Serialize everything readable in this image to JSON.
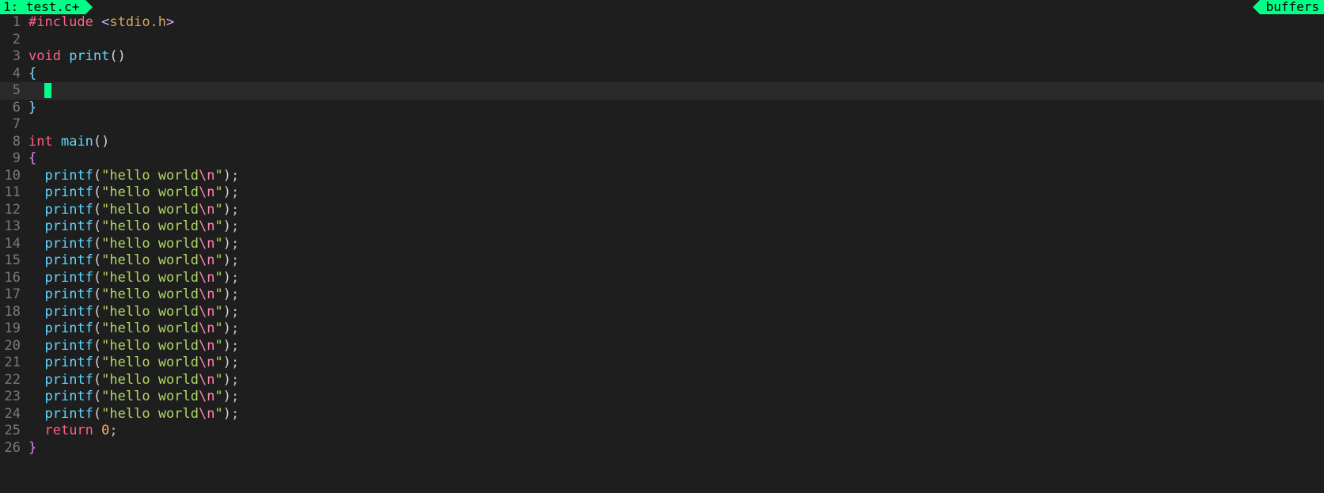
{
  "topbar": {
    "tab_label": "1: test.c+",
    "buffers_label": "buffers"
  },
  "editor": {
    "cursor_line": 5,
    "lines": [
      {
        "n": 1,
        "tokens": [
          [
            "kw-red",
            "#include "
          ],
          [
            "angle",
            "<"
          ],
          [
            "hdr",
            "stdio.h"
          ],
          [
            "angle",
            ">"
          ]
        ]
      },
      {
        "n": 2,
        "tokens": []
      },
      {
        "n": 3,
        "tokens": [
          [
            "kw-red",
            "void "
          ],
          [
            "fn-blue",
            "print"
          ],
          [
            "paren",
            "()"
          ]
        ]
      },
      {
        "n": 4,
        "tokens": [
          [
            "brace",
            "{"
          ]
        ]
      },
      {
        "n": 5,
        "tokens": [
          [
            "plain",
            "  "
          ],
          [
            "__CURSOR__",
            ""
          ]
        ]
      },
      {
        "n": 6,
        "tokens": [
          [
            "brace",
            "}"
          ]
        ]
      },
      {
        "n": 7,
        "tokens": []
      },
      {
        "n": 8,
        "tokens": [
          [
            "kw-red",
            "int "
          ],
          [
            "fn-blue",
            "main"
          ],
          [
            "paren",
            "()"
          ]
        ]
      },
      {
        "n": 9,
        "tokens": [
          [
            "brace2",
            "{"
          ]
        ]
      },
      {
        "n": 10,
        "tokens": [
          [
            "plain",
            "  "
          ],
          [
            "fn-blue",
            "printf"
          ],
          [
            "paren",
            "("
          ],
          [
            "dq",
            "\""
          ],
          [
            "str",
            "hello world"
          ],
          [
            "esc",
            "\\n"
          ],
          [
            "dq",
            "\""
          ],
          [
            "paren",
            ")"
          ],
          [
            "punct",
            ";"
          ]
        ]
      },
      {
        "n": 11,
        "tokens": [
          [
            "plain",
            "  "
          ],
          [
            "fn-blue",
            "printf"
          ],
          [
            "paren",
            "("
          ],
          [
            "dq",
            "\""
          ],
          [
            "str",
            "hello world"
          ],
          [
            "esc",
            "\\n"
          ],
          [
            "dq",
            "\""
          ],
          [
            "paren",
            ")"
          ],
          [
            "punct",
            ";"
          ]
        ]
      },
      {
        "n": 12,
        "tokens": [
          [
            "plain",
            "  "
          ],
          [
            "fn-blue",
            "printf"
          ],
          [
            "paren",
            "("
          ],
          [
            "dq",
            "\""
          ],
          [
            "str",
            "hello world"
          ],
          [
            "esc",
            "\\n"
          ],
          [
            "dq",
            "\""
          ],
          [
            "paren",
            ")"
          ],
          [
            "punct",
            ";"
          ]
        ]
      },
      {
        "n": 13,
        "tokens": [
          [
            "plain",
            "  "
          ],
          [
            "fn-blue",
            "printf"
          ],
          [
            "paren",
            "("
          ],
          [
            "dq",
            "\""
          ],
          [
            "str",
            "hello world"
          ],
          [
            "esc",
            "\\n"
          ],
          [
            "dq",
            "\""
          ],
          [
            "paren",
            ")"
          ],
          [
            "punct",
            ";"
          ]
        ]
      },
      {
        "n": 14,
        "tokens": [
          [
            "plain",
            "  "
          ],
          [
            "fn-blue",
            "printf"
          ],
          [
            "paren",
            "("
          ],
          [
            "dq",
            "\""
          ],
          [
            "str",
            "hello world"
          ],
          [
            "esc",
            "\\n"
          ],
          [
            "dq",
            "\""
          ],
          [
            "paren",
            ")"
          ],
          [
            "punct",
            ";"
          ]
        ]
      },
      {
        "n": 15,
        "tokens": [
          [
            "plain",
            "  "
          ],
          [
            "fn-blue",
            "printf"
          ],
          [
            "paren",
            "("
          ],
          [
            "dq",
            "\""
          ],
          [
            "str",
            "hello world"
          ],
          [
            "esc",
            "\\n"
          ],
          [
            "dq",
            "\""
          ],
          [
            "paren",
            ")"
          ],
          [
            "punct",
            ";"
          ]
        ]
      },
      {
        "n": 16,
        "tokens": [
          [
            "plain",
            "  "
          ],
          [
            "fn-blue",
            "printf"
          ],
          [
            "paren",
            "("
          ],
          [
            "dq",
            "\""
          ],
          [
            "str",
            "hello world"
          ],
          [
            "esc",
            "\\n"
          ],
          [
            "dq",
            "\""
          ],
          [
            "paren",
            ")"
          ],
          [
            "punct",
            ";"
          ]
        ]
      },
      {
        "n": 17,
        "tokens": [
          [
            "plain",
            "  "
          ],
          [
            "fn-blue",
            "printf"
          ],
          [
            "paren",
            "("
          ],
          [
            "dq",
            "\""
          ],
          [
            "str",
            "hello world"
          ],
          [
            "esc",
            "\\n"
          ],
          [
            "dq",
            "\""
          ],
          [
            "paren",
            ")"
          ],
          [
            "punct",
            ";"
          ]
        ]
      },
      {
        "n": 18,
        "tokens": [
          [
            "plain",
            "  "
          ],
          [
            "fn-blue",
            "printf"
          ],
          [
            "paren",
            "("
          ],
          [
            "dq",
            "\""
          ],
          [
            "str",
            "hello world"
          ],
          [
            "esc",
            "\\n"
          ],
          [
            "dq",
            "\""
          ],
          [
            "paren",
            ")"
          ],
          [
            "punct",
            ";"
          ]
        ]
      },
      {
        "n": 19,
        "tokens": [
          [
            "plain",
            "  "
          ],
          [
            "fn-blue",
            "printf"
          ],
          [
            "paren",
            "("
          ],
          [
            "dq",
            "\""
          ],
          [
            "str",
            "hello world"
          ],
          [
            "esc",
            "\\n"
          ],
          [
            "dq",
            "\""
          ],
          [
            "paren",
            ")"
          ],
          [
            "punct",
            ";"
          ]
        ]
      },
      {
        "n": 20,
        "tokens": [
          [
            "plain",
            "  "
          ],
          [
            "fn-blue",
            "printf"
          ],
          [
            "paren",
            "("
          ],
          [
            "dq",
            "\""
          ],
          [
            "str",
            "hello world"
          ],
          [
            "esc",
            "\\n"
          ],
          [
            "dq",
            "\""
          ],
          [
            "paren",
            ")"
          ],
          [
            "punct",
            ";"
          ]
        ]
      },
      {
        "n": 21,
        "tokens": [
          [
            "plain",
            "  "
          ],
          [
            "fn-blue",
            "printf"
          ],
          [
            "paren",
            "("
          ],
          [
            "dq",
            "\""
          ],
          [
            "str",
            "hello world"
          ],
          [
            "esc",
            "\\n"
          ],
          [
            "dq",
            "\""
          ],
          [
            "paren",
            ")"
          ],
          [
            "punct",
            ";"
          ]
        ]
      },
      {
        "n": 22,
        "tokens": [
          [
            "plain",
            "  "
          ],
          [
            "fn-blue",
            "printf"
          ],
          [
            "paren",
            "("
          ],
          [
            "dq",
            "\""
          ],
          [
            "str",
            "hello world"
          ],
          [
            "esc",
            "\\n"
          ],
          [
            "dq",
            "\""
          ],
          [
            "paren",
            ")"
          ],
          [
            "punct",
            ";"
          ]
        ]
      },
      {
        "n": 23,
        "tokens": [
          [
            "plain",
            "  "
          ],
          [
            "fn-blue",
            "printf"
          ],
          [
            "paren",
            "("
          ],
          [
            "dq",
            "\""
          ],
          [
            "str",
            "hello world"
          ],
          [
            "esc",
            "\\n"
          ],
          [
            "dq",
            "\""
          ],
          [
            "paren",
            ")"
          ],
          [
            "punct",
            ";"
          ]
        ]
      },
      {
        "n": 24,
        "tokens": [
          [
            "plain",
            "  "
          ],
          [
            "fn-blue",
            "printf"
          ],
          [
            "paren",
            "("
          ],
          [
            "dq",
            "\""
          ],
          [
            "str",
            "hello world"
          ],
          [
            "esc",
            "\\n"
          ],
          [
            "dq",
            "\""
          ],
          [
            "paren",
            ")"
          ],
          [
            "punct",
            ";"
          ]
        ]
      },
      {
        "n": 25,
        "tokens": [
          [
            "plain",
            "  "
          ],
          [
            "kw-red",
            "return "
          ],
          [
            "num",
            "0"
          ],
          [
            "punct",
            ";"
          ]
        ]
      },
      {
        "n": 26,
        "tokens": [
          [
            "brace2",
            "}"
          ]
        ]
      }
    ]
  }
}
